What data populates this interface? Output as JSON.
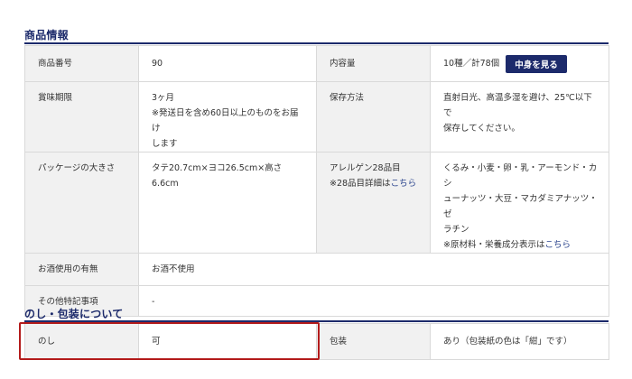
{
  "product_info": {
    "title": "商品情報",
    "rows": [
      {
        "left_label": "商品番号",
        "left_value": [
          "90"
        ],
        "right_label": "内容量",
        "right_value": [
          "10種／計78個"
        ],
        "button": "中身を見る"
      },
      {
        "left_label": "賞味期限",
        "left_value": [
          "3ヶ月",
          "※発送日を含め60日以上のものをお届け",
          "します"
        ],
        "right_label": "保存方法",
        "right_value": [
          "直射日光、高温多湿を避け、25℃以下で",
          "保存してください。"
        ]
      },
      {
        "left_label": "パッケージの大きさ",
        "left_value": [
          "タテ20.7cm×ヨコ26.5cm×高さ6.6cm"
        ],
        "right_label": "アレルゲン28品目",
        "right_label_note": "※28品目詳細は",
        "right_label_link": "こちら",
        "right_value": [
          "くるみ・小麦・卵・乳・アーモンド・カシ",
          "ューナッツ・大豆・マカダミアナッツ・ゼ",
          "ラチン"
        ],
        "right_value_note": "※原材料・栄養成分表示は",
        "right_value_link": "こちら"
      },
      {
        "label": "お酒使用の有無",
        "value": "お酒不使用"
      },
      {
        "label": "その他特記事項",
        "value": "-"
      }
    ]
  },
  "noshi": {
    "title": "のし・包装について",
    "rows": [
      {
        "left_label": "のし",
        "left_value": "可",
        "right_label": "包装",
        "right_value": "あり（包装紙の色は「紺」です）"
      }
    ]
  },
  "colors": {
    "accent": "#1c2a6b",
    "highlight": "#b31b1b",
    "label_bg": "#f1f1f1",
    "border": "#d9d9d9",
    "link": "#26408b"
  }
}
